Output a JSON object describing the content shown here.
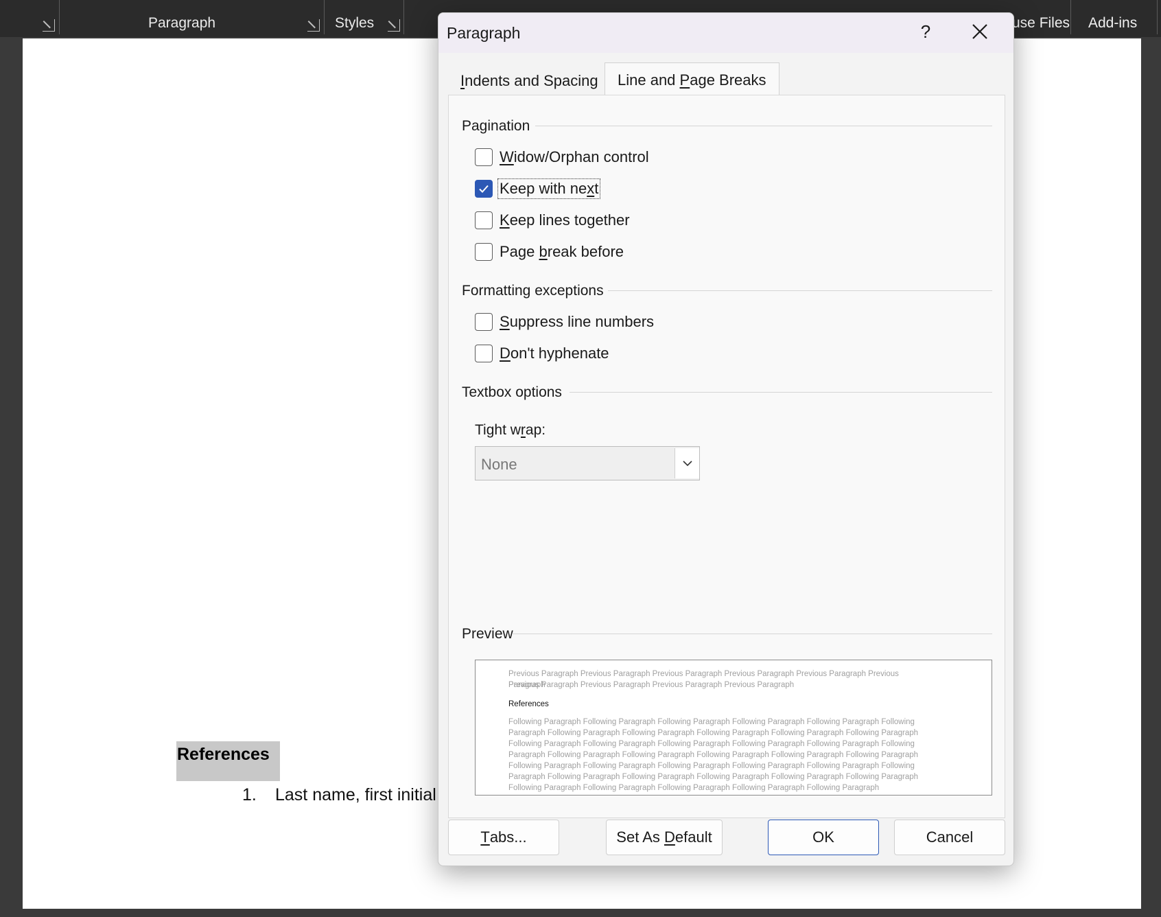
{
  "ribbon": {
    "paragraph_group": "Paragraph",
    "styles_group": "Styles",
    "reuse_files": "use Files",
    "add_ins": "Add-ins"
  },
  "document": {
    "heading": "References",
    "list_number": "1.",
    "list_text": "Last name, first initial."
  },
  "dialog": {
    "title": "Paragraph",
    "help": "?",
    "tabs": {
      "indents_pre": "",
      "indents_ul": "I",
      "indents_post": "ndents and Spacing",
      "breaks_pre": "Line and ",
      "breaks_ul": "P",
      "breaks_post": "age Breaks"
    },
    "pagination": {
      "title": "Pagination",
      "widow": {
        "pre": "",
        "ul": "W",
        "post": "idow/Orphan control",
        "checked": false
      },
      "keep_next": {
        "pre": "Keep with ne",
        "ul": "x",
        "post": "t",
        "checked": true
      },
      "keep_lines": {
        "pre": "",
        "ul": "K",
        "post": "eep lines together",
        "checked": false
      },
      "page_break": {
        "pre": "Page ",
        "ul": "b",
        "post": "reak before",
        "checked": false
      }
    },
    "formatting": {
      "title": "Formatting exceptions",
      "suppress": {
        "pre": "",
        "ul": "S",
        "post": "uppress line numbers",
        "checked": false
      },
      "hyphenate": {
        "pre": "",
        "ul": "D",
        "post": "on't hyphenate",
        "checked": false
      }
    },
    "textbox": {
      "title": "Textbox options",
      "wrap_pre": "Tight w",
      "wrap_ul": "r",
      "wrap_post": "ap:",
      "wrap_value": "None"
    },
    "preview": {
      "title": "Preview",
      "previous_1": "Previous Paragraph Previous Paragraph Previous Paragraph Previous Paragraph Previous Paragraph Previous Paragraph",
      "previous_2": "Previous Paragraph Previous Paragraph Previous Paragraph Previous Paragraph",
      "current": "References",
      "following": [
        "Following Paragraph Following Paragraph Following Paragraph Following Paragraph Following Paragraph Following",
        "Paragraph Following Paragraph Following Paragraph Following Paragraph Following Paragraph Following Paragraph",
        "Following Paragraph Following Paragraph Following Paragraph Following Paragraph Following Paragraph Following",
        "Paragraph Following Paragraph Following Paragraph Following Paragraph Following Paragraph Following Paragraph",
        "Following Paragraph Following Paragraph Following Paragraph Following Paragraph Following Paragraph Following",
        "Paragraph Following Paragraph Following Paragraph Following Paragraph Following Paragraph Following Paragraph",
        "Following Paragraph Following Paragraph Following Paragraph Following Paragraph Following Paragraph"
      ]
    },
    "buttons": {
      "tabs_pre": "",
      "tabs_ul": "T",
      "tabs_post": "abs...",
      "default_pre": "Set As ",
      "default_ul": "D",
      "default_post": "efault",
      "ok": "OK",
      "cancel": "Cancel"
    }
  },
  "colors": {
    "accent": "#2c58b5",
    "ribbon": "#2b2b2b",
    "highlight": "#c8c8c8"
  }
}
